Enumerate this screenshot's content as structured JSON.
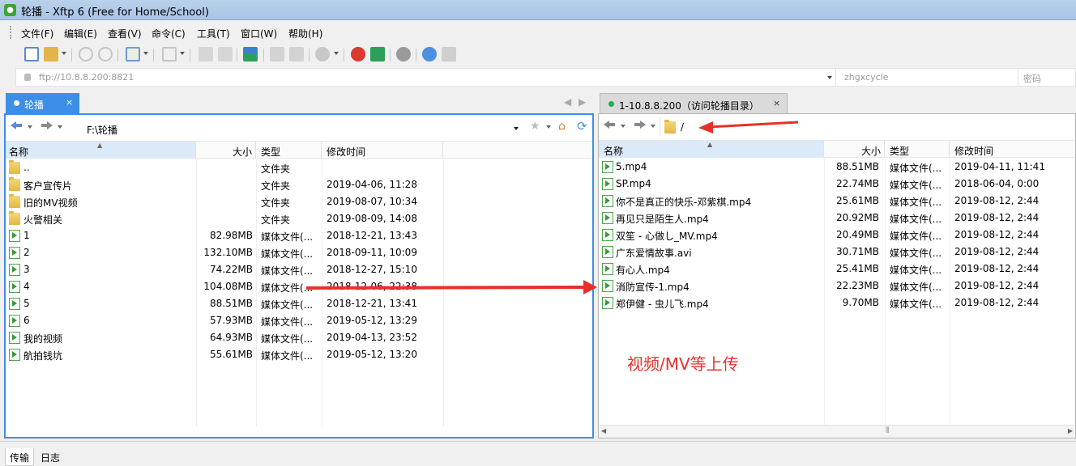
{
  "window": {
    "title": "轮播 - Xftp 6 (Free for Home/School)"
  },
  "menu": [
    "文件(F)",
    "编辑(E)",
    "查看(V)",
    "命令(C)",
    "工具(T)",
    "窗口(W)",
    "帮助(H)"
  ],
  "address": {
    "url": "ftp://10.8.8.200:8821",
    "username": "zhgxcycle",
    "password_placeholder": "密码"
  },
  "left_tab": {
    "label": "轮播",
    "close": "×"
  },
  "right_tab": {
    "label": "1-10.8.8.200（访问轮播目录）",
    "close": "×",
    "status_color": "#22b14c"
  },
  "tab_nav": {
    "prev": "◀",
    "next": "▶"
  },
  "left": {
    "path": "F:\\轮播",
    "columns": [
      "名称",
      "大小",
      "类型",
      "修改时间"
    ],
    "rows": [
      {
        "name": "..",
        "size": "",
        "type": "文件夹",
        "modified": "",
        "icon": "folder-icon"
      },
      {
        "name": "客户宣传片",
        "size": "",
        "type": "文件夹",
        "modified": "2019-04-06, 11:28",
        "icon": "folder-icon"
      },
      {
        "name": "旧的MV视频",
        "size": "",
        "type": "文件夹",
        "modified": "2019-08-07, 10:34",
        "icon": "folder-icon"
      },
      {
        "name": "火警相关",
        "size": "",
        "type": "文件夹",
        "modified": "2019-08-09, 14:08",
        "icon": "folder-icon"
      },
      {
        "name": "1",
        "size": "82.98MB",
        "type": "媒体文件(...",
        "modified": "2018-12-21, 13:43",
        "icon": "media-file-icon"
      },
      {
        "name": "2",
        "size": "132.10MB",
        "type": "媒体文件(...",
        "modified": "2018-09-11, 10:09",
        "icon": "media-file-icon"
      },
      {
        "name": "3",
        "size": "74.22MB",
        "type": "媒体文件(...",
        "modified": "2018-12-27, 15:10",
        "icon": "media-file-icon"
      },
      {
        "name": "4",
        "size": "104.08MB",
        "type": "媒体文件(...",
        "modified": "2018-12-06, 22:38",
        "icon": "media-file-icon"
      },
      {
        "name": "5",
        "size": "88.51MB",
        "type": "媒体文件(...",
        "modified": "2018-12-21, 13:41",
        "icon": "media-file-icon"
      },
      {
        "name": "6",
        "size": "57.93MB",
        "type": "媒体文件(...",
        "modified": "2019-05-12, 13:29",
        "icon": "media-file-icon"
      },
      {
        "name": "我的视频",
        "size": "64.93MB",
        "type": "媒体文件(...",
        "modified": "2019-04-13, 23:52",
        "icon": "media-file-icon"
      },
      {
        "name": "航拍钱坑",
        "size": "55.61MB",
        "type": "媒体文件(...",
        "modified": "2019-05-12, 13:20",
        "icon": "media-file-icon"
      }
    ]
  },
  "right": {
    "path": "/",
    "columns": [
      "名称",
      "大小",
      "类型",
      "修改时间"
    ],
    "rows": [
      {
        "name": "5.mp4",
        "size": "88.51MB",
        "type": "媒体文件(...",
        "modified": "2019-04-11, 11:41",
        "icon": "media-file-icon"
      },
      {
        "name": "SP.mp4",
        "size": "22.74MB",
        "type": "媒体文件(...",
        "modified": "2018-06-04, 0:00",
        "icon": "media-file-icon"
      },
      {
        "name": "你不是真正的快乐-邓紫棋.mp4",
        "size": "25.61MB",
        "type": "媒体文件(...",
        "modified": "2019-08-12, 2:44",
        "icon": "media-file-icon"
      },
      {
        "name": "再见只是陌生人.mp4",
        "size": "20.92MB",
        "type": "媒体文件(...",
        "modified": "2019-08-12, 2:44",
        "icon": "media-file-icon"
      },
      {
        "name": "双笙 - 心做し_MV.mp4",
        "size": "20.49MB",
        "type": "媒体文件(...",
        "modified": "2019-08-12, 2:44",
        "icon": "media-file-icon"
      },
      {
        "name": "广东爱情故事.avi",
        "size": "30.71MB",
        "type": "媒体文件(...",
        "modified": "2019-08-12, 2:44",
        "icon": "media-file-icon"
      },
      {
        "name": "有心人.mp4",
        "size": "25.41MB",
        "type": "媒体文件(...",
        "modified": "2019-08-12, 2:44",
        "icon": "media-file-icon"
      },
      {
        "name": "消防宣传-1.mp4",
        "size": "22.23MB",
        "type": "媒体文件(...",
        "modified": "2019-08-12, 2:44",
        "icon": "media-file-icon"
      },
      {
        "name": "郑伊健 - 虫儿飞.mp4",
        "size": "9.70MB",
        "type": "媒体文件(...",
        "modified": "2019-08-12, 2:44",
        "icon": "media-file-icon"
      }
    ],
    "scroll_grip": "⦀"
  },
  "annotation": {
    "text": "视频/MV等上传",
    "color": "#e8302a"
  },
  "statusbar": {
    "tabs": [
      "传输",
      "日志"
    ]
  },
  "colors": {
    "accent": "#3d8ee6",
    "titlebar": "#b9d1ea",
    "selected_header": "#dbeaf8"
  }
}
